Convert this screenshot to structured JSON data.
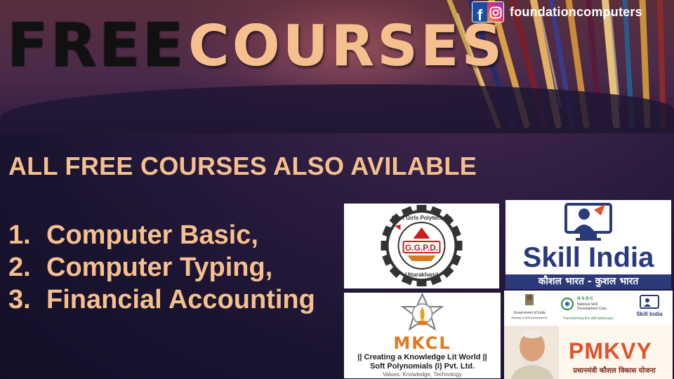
{
  "header": {
    "social_handle": "foundationcomputers",
    "icons": [
      "facebook-icon",
      "instagram-icon"
    ]
  },
  "title": {
    "free": "FREE",
    "courses": "COURSES"
  },
  "subtitle": "ALL FREE COURSES ALSO AVILABLE",
  "courses": [
    {
      "num": "1.",
      "name": "Computer Basic,"
    },
    {
      "num": "2.",
      "name": "Computer Typing,"
    },
    {
      "num": "3.",
      "name": "Financial Accounting"
    }
  ],
  "logos": {
    "ggpd": {
      "abbrev": "G.G.P.D.",
      "ring_text": "Government Girls Polytechnic Dehradun",
      "bottom_text": "Uttarakhand"
    },
    "skill_india": {
      "wordmark": "Skill India",
      "tagline": "कौशल भारत - कुशल भारत"
    },
    "mkcl": {
      "name": "MKCL",
      "slogan": "|| Creating a Knowledge Lit World ||",
      "company": "Soft Polynomials (I) Pvt. Ltd.",
      "values": "Values, Knowledge, Technology"
    },
    "pmkvy": {
      "wordmark": "PMKVY",
      "hindi": "प्रधानमंत्री कौशल विकास योजना",
      "nsdc": "N·S·D·C",
      "nsdc_name": "National Skill Development Corporation",
      "nsdc_tag": "Transforming the skill landscape",
      "ministry": "Government of India Ministry of Skill Development & Entrepreneurship",
      "skill_small": "Skill India"
    }
  },
  "colors": {
    "accent_peach": "#f5c08e",
    "title_black": "#111111",
    "skill_navy": "#2a3a7a",
    "mkcl_orange": "#e07a1f",
    "pmkvy_red": "#e0522a"
  }
}
